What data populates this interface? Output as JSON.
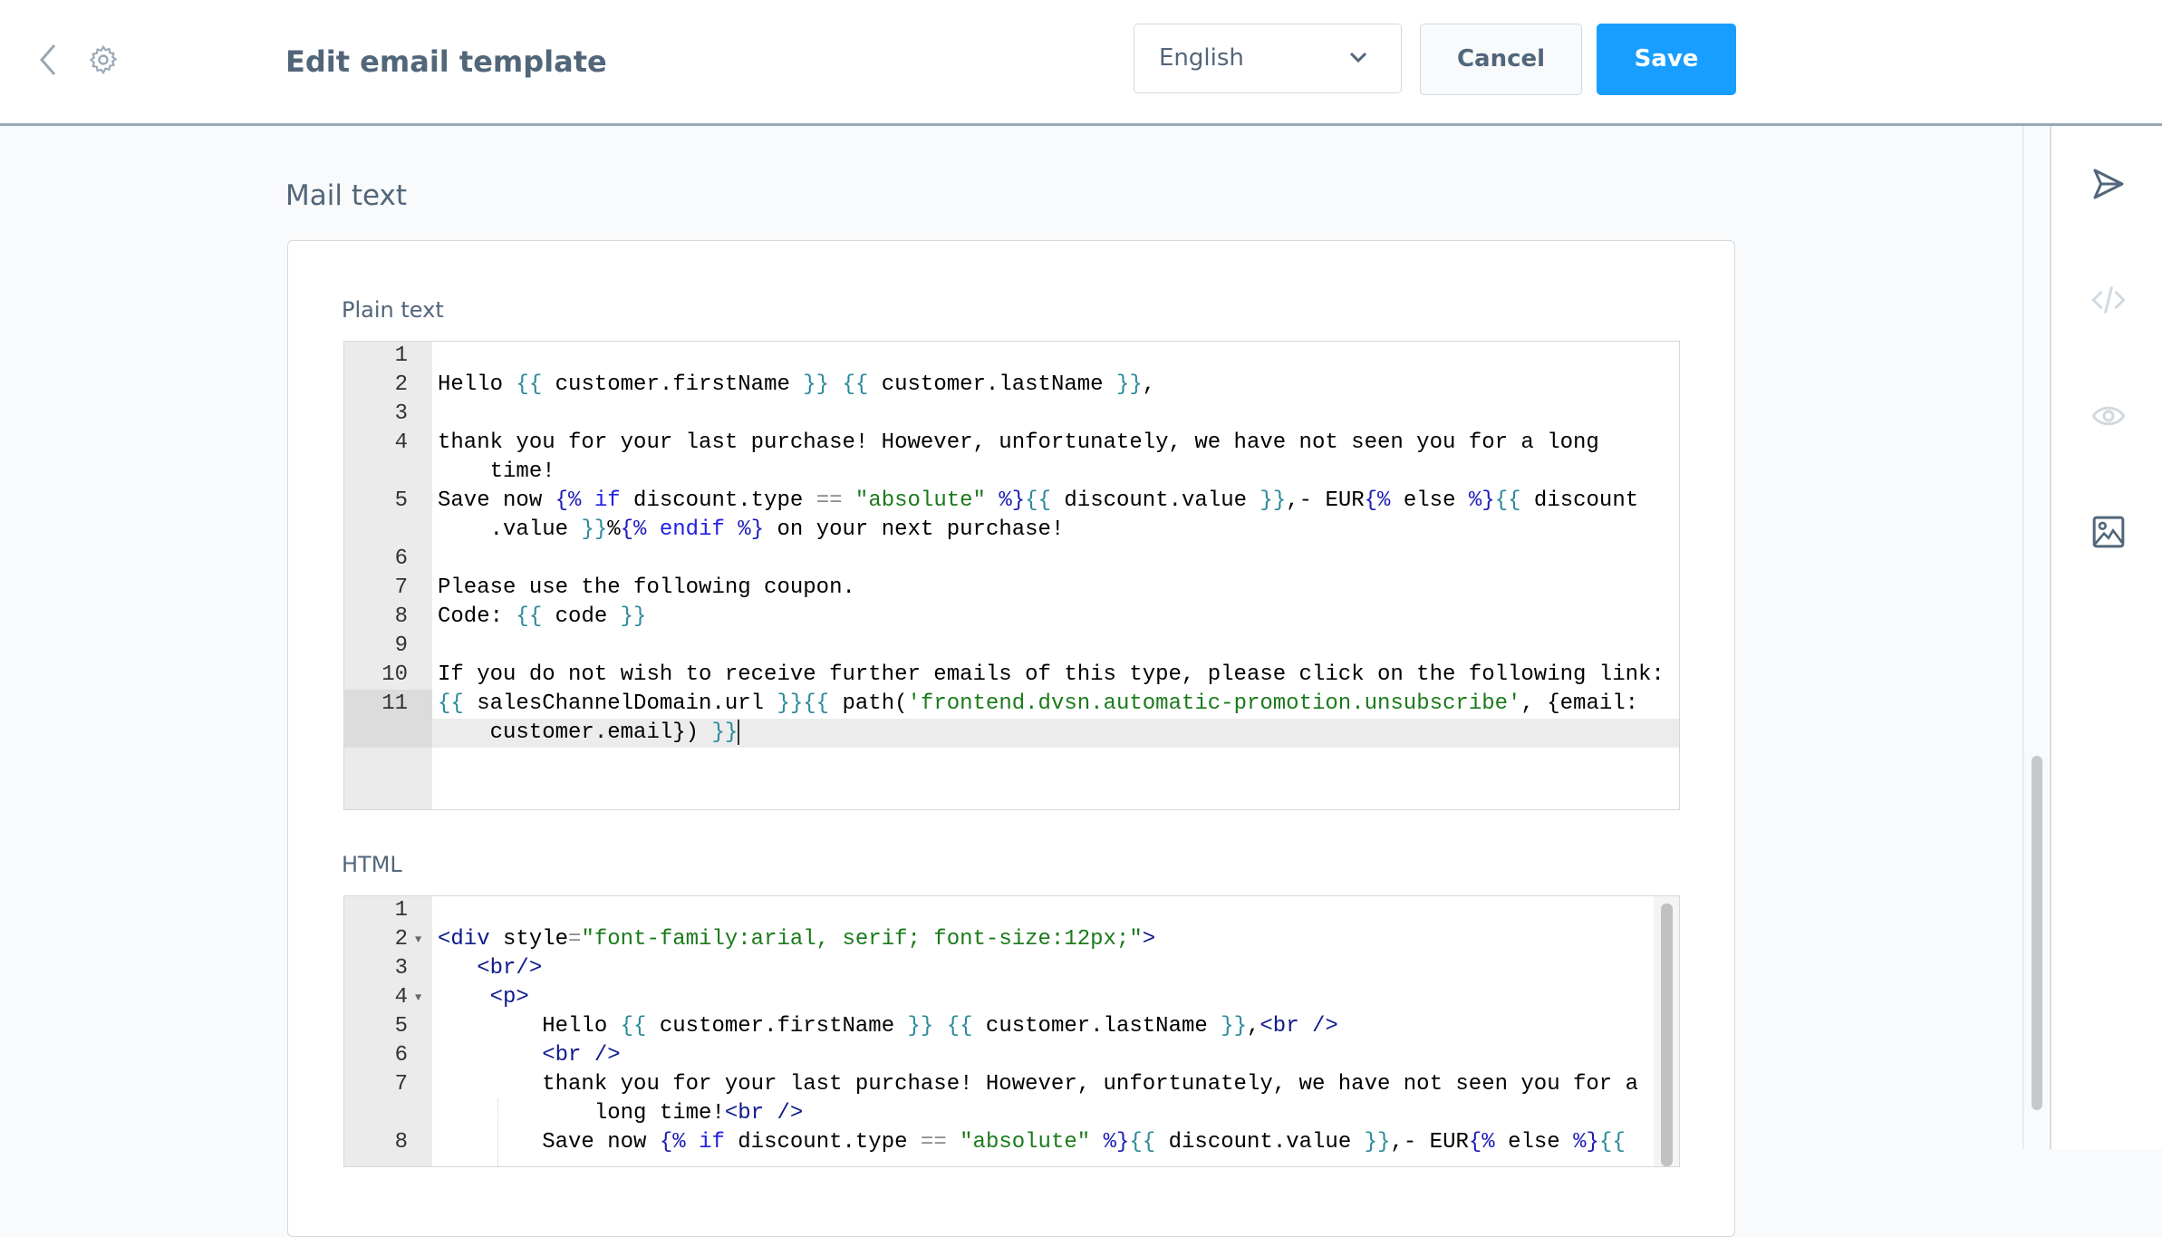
{
  "header": {
    "title": "Edit email template",
    "language": "English",
    "cancel_label": "Cancel",
    "save_label": "Save",
    "icons": [
      "chevron-left-icon",
      "gear-icon",
      "chevron-down-icon"
    ]
  },
  "colors": {
    "accent": "#189eff",
    "text": "#52667a",
    "border": "#d1d9e0"
  },
  "sidebar": {
    "icons": [
      "send-icon",
      "code-icon",
      "eye-icon",
      "image-icon"
    ]
  },
  "main": {
    "section_title": "Mail text",
    "plain": {
      "label": "Plain text",
      "active_line": 11,
      "lines": [
        {
          "n": "1",
          "rows": [
            []
          ]
        },
        {
          "n": "2",
          "rows": [
            [
              [
                "t",
                "Hello "
              ],
              [
                "v",
                "{{"
              ],
              [
                "t",
                " customer.firstName "
              ],
              [
                "v",
                "}}"
              ],
              [
                "t",
                " "
              ],
              [
                "v",
                "{{"
              ],
              [
                "t",
                " customer.lastName "
              ],
              [
                "v",
                "}}"
              ],
              [
                "t",
                ","
              ]
            ]
          ]
        },
        {
          "n": "3",
          "rows": [
            []
          ]
        },
        {
          "n": "4",
          "rows": [
            [
              [
                "t",
                "thank you for your last purchase! However, unfortunately, we have not seen you for a long"
              ]
            ],
            [
              [
                "t",
                "    time!"
              ]
            ]
          ]
        },
        {
          "n": "5",
          "rows": [
            [
              [
                "t",
                "Save now "
              ],
              [
                "d",
                "{%"
              ],
              [
                "t",
                " "
              ],
              [
                "k",
                "if"
              ],
              [
                "t",
                " discount.type "
              ],
              [
                "o",
                "=="
              ],
              [
                "t",
                " "
              ],
              [
                "s",
                "\"absolute\""
              ],
              [
                "t",
                " "
              ],
              [
                "d",
                "%}"
              ],
              [
                "v",
                "{{"
              ],
              [
                "t",
                " discount.value "
              ],
              [
                "v",
                "}}"
              ],
              [
                "t",
                ",- EUR"
              ],
              [
                "d",
                "{%"
              ],
              [
                "t",
                " else "
              ],
              [
                "d",
                "%}"
              ],
              [
                "v",
                "{{"
              ],
              [
                "t",
                " discount"
              ]
            ],
            [
              [
                "t",
                "    .value "
              ],
              [
                "v",
                "}}"
              ],
              [
                "t",
                "%"
              ],
              [
                "d",
                "{%"
              ],
              [
                "k",
                " endif "
              ],
              [
                "d",
                "%}"
              ],
              [
                "t",
                " on your next purchase!"
              ]
            ]
          ]
        },
        {
          "n": "6",
          "rows": [
            []
          ]
        },
        {
          "n": "7",
          "rows": [
            [
              [
                "t",
                "Please use the following coupon."
              ]
            ]
          ]
        },
        {
          "n": "8",
          "rows": [
            [
              [
                "t",
                "Code: "
              ],
              [
                "v",
                "{{"
              ],
              [
                "t",
                " code "
              ],
              [
                "v",
                "}}"
              ]
            ]
          ]
        },
        {
          "n": "9",
          "rows": [
            []
          ]
        },
        {
          "n": "10",
          "rows": [
            [
              [
                "t",
                "If you do not wish to receive further emails of this type, please click on the following link:"
              ]
            ]
          ]
        },
        {
          "n": "11",
          "rows": [
            [
              [
                "v",
                "{{"
              ],
              [
                "t",
                " salesChannelDomain.url "
              ],
              [
                "v",
                "}}"
              ],
              [
                "v",
                "{{"
              ],
              [
                "t",
                " path("
              ],
              [
                "s",
                "'frontend.dvsn.automatic-promotion.unsubscribe'"
              ],
              [
                "t",
                ", {email:"
              ]
            ],
            [
              [
                "t",
                "    customer.email}) "
              ],
              [
                "v",
                "}}"
              ]
            ]
          ]
        }
      ]
    },
    "html": {
      "label": "HTML",
      "lines": [
        {
          "n": "1",
          "rows": [
            []
          ]
        },
        {
          "n": "2",
          "fold": true,
          "rows": [
            [
              [
                "tag",
                "<div"
              ],
              [
                "a",
                " style"
              ],
              [
                "o",
                "="
              ],
              [
                "s",
                "\"font-family:arial, serif; font-size:12px;\""
              ],
              [
                "tag",
                ">"
              ]
            ]
          ]
        },
        {
          "n": "3",
          "rows": [
            [
              [
                "t",
                "   "
              ],
              [
                "tag",
                "<br/>"
              ]
            ]
          ]
        },
        {
          "n": "4",
          "fold": true,
          "rows": [
            [
              [
                "t",
                "    "
              ],
              [
                "tag",
                "<p>"
              ]
            ]
          ]
        },
        {
          "n": "5",
          "rows": [
            [
              [
                "t",
                "        Hello "
              ],
              [
                "v",
                "{{"
              ],
              [
                "t",
                " customer.firstName "
              ],
              [
                "v",
                "}}"
              ],
              [
                "t",
                " "
              ],
              [
                "v",
                "{{"
              ],
              [
                "t",
                " customer.lastName "
              ],
              [
                "v",
                "}}"
              ],
              [
                "t",
                ","
              ],
              [
                "tag",
                "<br />"
              ]
            ]
          ]
        },
        {
          "n": "6",
          "rows": [
            [
              [
                "t",
                "        "
              ],
              [
                "tag",
                "<br />"
              ]
            ]
          ]
        },
        {
          "n": "7",
          "rows": [
            [
              [
                "t",
                "        thank you for your last purchase! However, unfortunately, we have not seen you for a"
              ]
            ],
            [
              [
                "t",
                "            long time!"
              ],
              [
                "tag",
                "<br />"
              ]
            ]
          ]
        },
        {
          "n": "8",
          "rows": [
            [
              [
                "t",
                "        Save now "
              ],
              [
                "d",
                "{%"
              ],
              [
                "t",
                " "
              ],
              [
                "k",
                "if"
              ],
              [
                "t",
                " discount.type "
              ],
              [
                "o",
                "=="
              ],
              [
                "t",
                " "
              ],
              [
                "s",
                "\"absolute\""
              ],
              [
                "t",
                " "
              ],
              [
                "d",
                "%}"
              ],
              [
                "v",
                "{{"
              ],
              [
                "t",
                " discount.value "
              ],
              [
                "v",
                "}}"
              ],
              [
                "t",
                ",- EUR"
              ],
              [
                "d",
                "{%"
              ],
              [
                "t",
                " else "
              ],
              [
                "d",
                "%}"
              ],
              [
                "v",
                "{{"
              ]
            ]
          ]
        }
      ]
    }
  }
}
